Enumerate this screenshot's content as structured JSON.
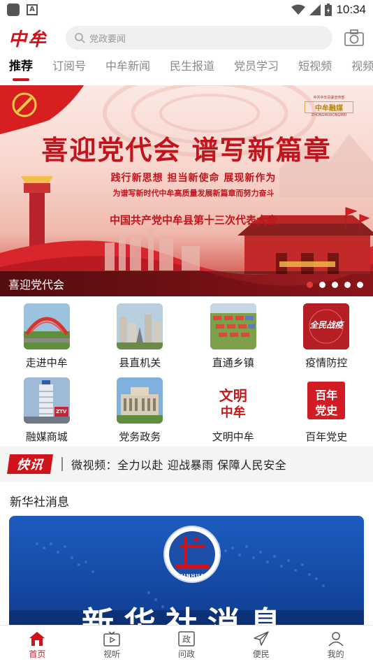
{
  "status_bar": {
    "time": "10:34"
  },
  "header": {
    "logo": "中牟",
    "search_placeholder": "党政要闻"
  },
  "tabs": [
    {
      "label": "推荐",
      "active": true
    },
    {
      "label": "订阅号",
      "active": false
    },
    {
      "label": "中牟新闻",
      "active": false
    },
    {
      "label": "民生报道",
      "active": false
    },
    {
      "label": "党员学习",
      "active": false
    },
    {
      "label": "短视频",
      "active": false
    },
    {
      "label": "视频",
      "active": false
    }
  ],
  "banner": {
    "headline": "喜迎党代会  谱写新篇章",
    "slogan": "践行新思想  担当新使命  展现新作为",
    "subslogan": "为谱写新时代中牟高质量发展新篇章而努力奋斗",
    "congress": "中国共产党中牟县第十三次代表大会",
    "brand_small": "中共中牟县委宣传部",
    "brand_main": "中牟融媒",
    "brand_en": "ZHONGMURONGMEI",
    "caption": "喜迎党代会",
    "slides_total": 5,
    "active_slide": 1
  },
  "grid": [
    {
      "label": "走进中牟",
      "icon": "bridge-photo"
    },
    {
      "label": "县直机关",
      "icon": "city-photo"
    },
    {
      "label": "直通乡镇",
      "icon": "town-photo"
    },
    {
      "label": "疫情防控",
      "icon": "anti-epidemic-badge"
    },
    {
      "label": "融媒商城",
      "icon": "tower-photo"
    },
    {
      "label": "党务政务",
      "icon": "government-building-photo"
    },
    {
      "label": "文明中牟",
      "icon": "civilization-seal"
    },
    {
      "label": "百年党史",
      "icon": "party-history-seal"
    }
  ],
  "grid_icon_text": {
    "epidemic": "全民战疫",
    "wenming_1": "文明",
    "wenming_2": "中牟",
    "bainian_1": "百年",
    "bainian_2": "党史",
    "ztv": "ZTV"
  },
  "ticker": {
    "badge": "快讯",
    "text": "微视频：全力以赴 迎战暴雨 保障人民安全"
  },
  "section": {
    "title": "新华社消息",
    "emblem_text": "XINHUA",
    "card_text": "新华社消息"
  },
  "bottom_nav": [
    {
      "label": "首页",
      "icon": "home-icon",
      "active": true
    },
    {
      "label": "视听",
      "icon": "tv-play-icon",
      "active": false
    },
    {
      "label": "问政",
      "icon": "politics-icon",
      "active": false
    },
    {
      "label": "便民",
      "icon": "send-icon",
      "active": false
    },
    {
      "label": "我的",
      "icon": "user-icon",
      "active": false
    }
  ],
  "colors": {
    "accent": "#d0121b",
    "banner_text": "#c2141c",
    "xinhua_blue": "#1448a3"
  }
}
